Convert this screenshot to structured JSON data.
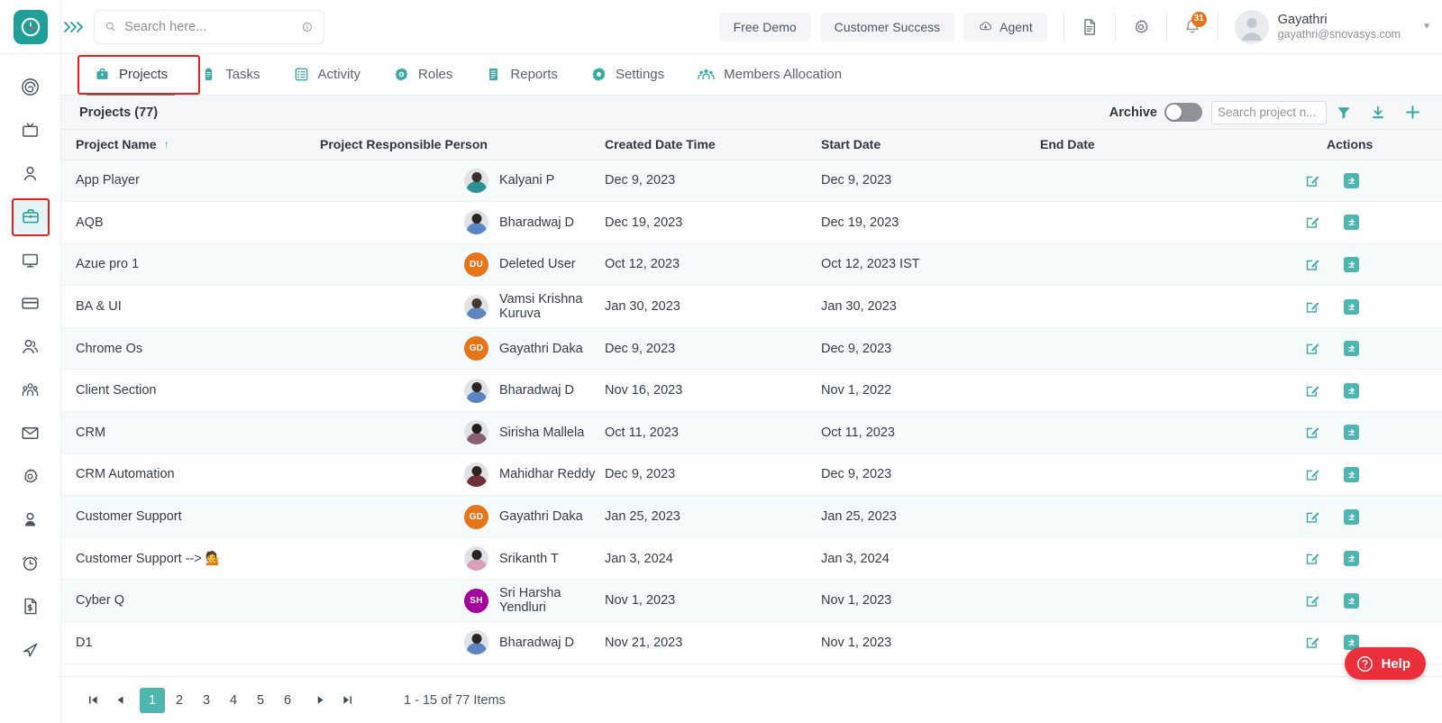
{
  "header": {
    "logo_icon": "clock-logo-icon",
    "expander_icon": "expand-chevrons-icon",
    "search": {
      "placeholder": "Search here...",
      "value": "",
      "icon": "search-icon",
      "info_icon": "info-icon"
    },
    "buttons": [
      {
        "name": "free-demo-button",
        "label": "Free Demo",
        "icon": null
      },
      {
        "name": "customer-success-button",
        "label": "Customer Success",
        "icon": null
      },
      {
        "name": "agent-button",
        "label": "Agent",
        "icon": "cloud-agent-icon"
      }
    ],
    "doc_icon": "document-icon",
    "settings_icon": "gear-icon",
    "notification_icon": "bell-icon",
    "notification_count": "31",
    "user": {
      "name": "Gayathri",
      "email": "gayathri@snovasys.com",
      "avatar_icon": "user-avatar-icon",
      "caret_icon": "chevron-down-icon"
    }
  },
  "sidebar": {
    "items": [
      {
        "name": "sidebar-item-dashboard",
        "icon": "target-spiral-icon",
        "active": false
      },
      {
        "name": "sidebar-item-tv",
        "icon": "tv-icon",
        "active": false
      },
      {
        "name": "sidebar-item-profile",
        "icon": "person-icon",
        "active": false
      },
      {
        "name": "sidebar-item-projects",
        "icon": "briefcase-icon",
        "active": true
      },
      {
        "name": "sidebar-item-monitor",
        "icon": "monitor-icon",
        "active": false
      },
      {
        "name": "sidebar-item-payments",
        "icon": "credit-card-icon",
        "active": false
      },
      {
        "name": "sidebar-item-users",
        "icon": "people-icon",
        "active": false
      },
      {
        "name": "sidebar-item-teams",
        "icon": "group-icon",
        "active": false
      },
      {
        "name": "sidebar-item-mail",
        "icon": "envelope-icon",
        "active": false
      },
      {
        "name": "sidebar-item-settings",
        "icon": "gear-icon",
        "active": false
      },
      {
        "name": "sidebar-item-account",
        "icon": "user-solid-icon",
        "active": false
      },
      {
        "name": "sidebar-item-timer",
        "icon": "alarm-clock-icon",
        "active": false
      },
      {
        "name": "sidebar-item-invoice",
        "icon": "invoice-icon",
        "active": false
      },
      {
        "name": "sidebar-item-send",
        "icon": "send-paper-plane-icon",
        "active": false
      }
    ]
  },
  "tabs": [
    {
      "name": "tab-projects",
      "label": "Projects",
      "icon": "briefcase-icon",
      "active": true
    },
    {
      "name": "tab-tasks",
      "label": "Tasks",
      "icon": "clipboard-icon",
      "active": false
    },
    {
      "name": "tab-activity",
      "label": "Activity",
      "icon": "list-grid-icon",
      "active": false
    },
    {
      "name": "tab-roles",
      "label": "Roles",
      "icon": "gear-circle-icon",
      "active": false
    },
    {
      "name": "tab-reports",
      "label": "Reports",
      "icon": "report-icon",
      "active": false
    },
    {
      "name": "tab-settings",
      "label": "Settings",
      "icon": "gear-icon",
      "active": false
    },
    {
      "name": "tab-members-allocation",
      "label": "Members Allocation",
      "icon": "people-group-icon",
      "active": false
    }
  ],
  "panel": {
    "title": "Projects (77)",
    "archive_label": "Archive",
    "archive_on": false,
    "search": {
      "placeholder": "Search project n...",
      "value": ""
    },
    "filter_icon": "filter-funnel-icon",
    "download_icon": "download-icon",
    "add_icon": "plus-icon"
  },
  "table": {
    "columns": [
      {
        "key": "name",
        "label": "Project Name",
        "sorted": true,
        "sort_icon": "sort-asc-arrow-icon"
      },
      {
        "key": "person",
        "label": "Project Responsible Person"
      },
      {
        "key": "created",
        "label": "Created Date Time"
      },
      {
        "key": "start",
        "label": "Start Date"
      },
      {
        "key": "end",
        "label": "End Date"
      },
      {
        "key": "actions",
        "label": "Actions"
      }
    ],
    "row_action_icons": {
      "edit": "edit-pencil-icon",
      "archive": "archive-box-icon"
    },
    "rows": [
      {
        "name": "App Player",
        "person": "Kalyani P",
        "avatar": {
          "type": "photo",
          "head": "#3a2f2c",
          "torso": "#2f8f92"
        },
        "created": "Dec 9, 2023",
        "start": "Dec 9, 2023",
        "end": ""
      },
      {
        "name": "AQB",
        "person": "Bharadwaj D",
        "avatar": {
          "type": "photo",
          "head": "#2b2522",
          "torso": "#5b86c4"
        },
        "created": "Dec 19, 2023",
        "start": "Dec 19, 2023",
        "end": ""
      },
      {
        "name": "Azue pro 1",
        "person": "Deleted User",
        "avatar": {
          "type": "initials",
          "text": "DU",
          "color": "#e8741a"
        },
        "created": "Oct 12, 2023",
        "start": "Oct 12, 2023 IST",
        "end": ""
      },
      {
        "name": "BA & UI",
        "person": "Vamsi Krishna Kuruva",
        "avatar": {
          "type": "photo",
          "head": "#4a372c",
          "torso": "#5f86bf"
        },
        "created": "Jan 30, 2023",
        "start": "Jan 30, 2023",
        "end": ""
      },
      {
        "name": "Chrome Os",
        "person": "Gayathri Daka",
        "avatar": {
          "type": "initials",
          "text": "GD",
          "color": "#e8741a"
        },
        "created": "Dec 9, 2023",
        "start": "Dec 9, 2023",
        "end": ""
      },
      {
        "name": "Client Section",
        "person": "Bharadwaj D",
        "avatar": {
          "type": "photo",
          "head": "#2b2522",
          "torso": "#5b86c4"
        },
        "created": "Nov 16, 2023",
        "start": "Nov 1, 2022",
        "end": ""
      },
      {
        "name": "CRM",
        "person": "Sirisha Mallela",
        "avatar": {
          "type": "photo",
          "head": "#231c1a",
          "torso": "#8a5f72"
        },
        "created": "Oct 11, 2023",
        "start": "Oct 11, 2023",
        "end": ""
      },
      {
        "name": "CRM Automation",
        "person": "Mahidhar Reddy",
        "avatar": {
          "type": "photo",
          "head": "#2e241f",
          "torso": "#6e2f36"
        },
        "created": "Dec 9, 2023",
        "start": "Dec 9, 2023",
        "end": ""
      },
      {
        "name": "Customer Support",
        "person": "Gayathri Daka",
        "avatar": {
          "type": "initials",
          "text": "GD",
          "color": "#e8741a"
        },
        "created": "Jan 25, 2023",
        "start": "Jan 25, 2023",
        "end": ""
      },
      {
        "name": "Customer Support --> 💁",
        "person": "Srikanth T",
        "avatar": {
          "type": "photo",
          "head": "#2c2320",
          "torso": "#d9a0bd"
        },
        "created": "Jan 3, 2024",
        "start": "Jan 3, 2024",
        "end": ""
      },
      {
        "name": "Cyber Q",
        "person": "Sri Harsha Yendluri",
        "avatar": {
          "type": "initials",
          "text": "SH",
          "color": "#a4009e"
        },
        "created": "Nov 1, 2023",
        "start": "Nov 1, 2023",
        "end": ""
      },
      {
        "name": "D1",
        "person": "Bharadwaj D",
        "avatar": {
          "type": "photo",
          "head": "#2b2522",
          "torso": "#5b86c4"
        },
        "created": "Nov 21, 2023",
        "start": "Nov 1, 2023",
        "end": ""
      }
    ]
  },
  "pagination": {
    "first_icon": "first-page-icon",
    "prev_icon": "prev-page-icon",
    "pages": [
      "1",
      "2",
      "3",
      "4",
      "5",
      "6"
    ],
    "current": "1",
    "next_icon": "next-page-icon",
    "last_icon": "last-page-icon",
    "info": "1 - 15 of 77 Items"
  },
  "help": {
    "label": "Help",
    "icon": "question-circle-icon"
  },
  "colors": {
    "accent": "#2aa39d",
    "accent_solid": "#4db6b0",
    "badge": "#e8741a",
    "help": "#ec2f3a",
    "highlight_box": "#f01b1b",
    "row_alt": "#f5fafa"
  }
}
